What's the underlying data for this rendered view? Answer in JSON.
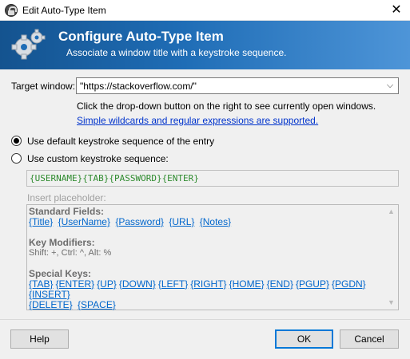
{
  "window": {
    "title": "Edit Auto-Type Item",
    "close_glyph": "✕",
    "app_icon": "keepass-lock-icon"
  },
  "banner": {
    "icon": "gears-icon",
    "heading": "Configure Auto-Type Item",
    "subheading": "Associate a window title with a keystroke sequence.",
    "gradient": [
      "#14538f",
      "#4e95d8"
    ]
  },
  "target": {
    "label": "Target window:",
    "value": "\"https://stackoverflow.com/\"",
    "hint": "Click the drop-down button on the right to see currently open windows.",
    "link": "Simple wildcards and regular expressions are supported."
  },
  "options": {
    "default_label": "Use default keystroke sequence of the entry",
    "custom_label": "Use custom keystroke sequence:",
    "selected": "default"
  },
  "sequence": {
    "value": "{USERNAME}{TAB}{PASSWORD}{ENTER}",
    "color": "#2e8b2e"
  },
  "placeholders": {
    "label": "Insert placeholder:",
    "standard_heading": "Standard Fields:",
    "standard": [
      "{Title}",
      "{UserName}",
      "{Password}",
      "{URL}",
      "{Notes}"
    ],
    "modifiers_heading": "Key Modifiers:",
    "modifiers_text": "Shift: +, Ctrl: ^, Alt: %",
    "special_heading": "Special Keys:",
    "special_row1": [
      "{TAB}",
      "{ENTER}",
      "{UP}",
      "{DOWN}",
      "{LEFT}",
      "{RIGHT}",
      "{HOME}",
      "{END}",
      "{PGUP}",
      "{PGDN}",
      "{INSERT}"
    ],
    "special_row2": [
      "{DELETE}",
      "{SPACE}"
    ]
  },
  "buttons": {
    "help": "Help",
    "ok": "OK",
    "cancel": "Cancel"
  }
}
